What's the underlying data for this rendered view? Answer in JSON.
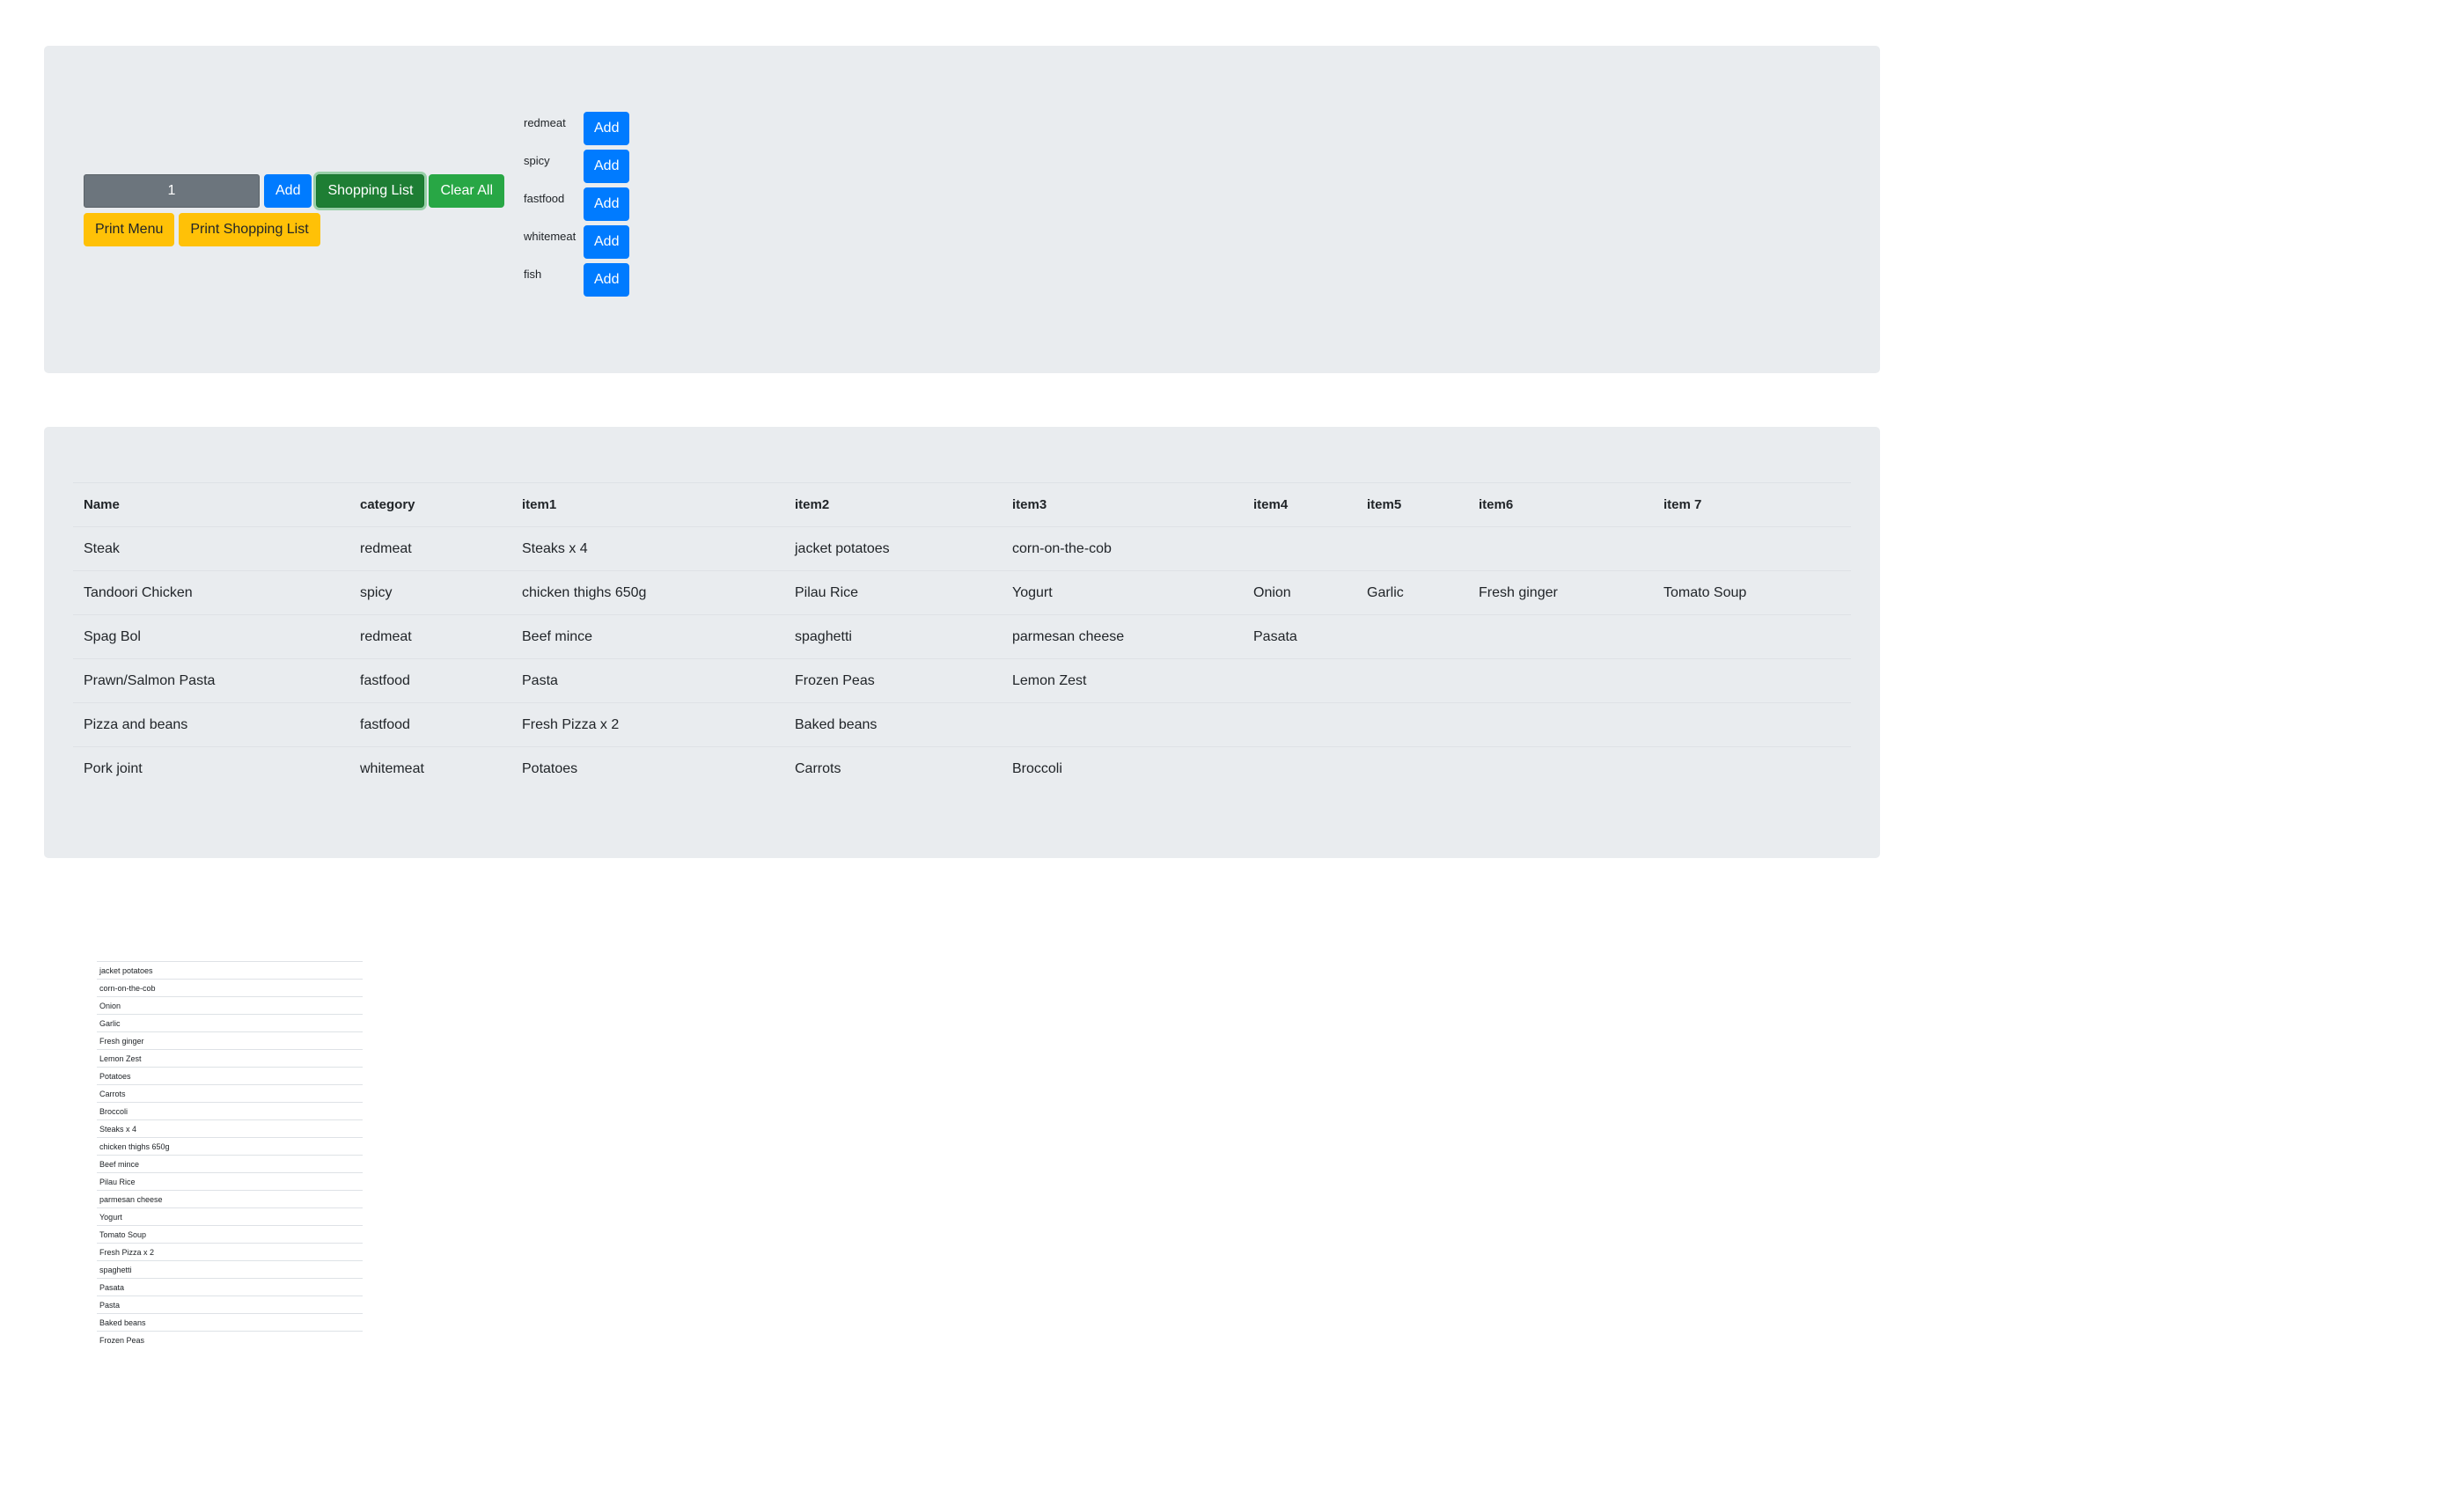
{
  "controls": {
    "quantity_value": "1",
    "add_label": "Add",
    "shopping_list_label": "Shopping List",
    "clear_all_label": "Clear All",
    "print_menu_label": "Print Menu",
    "print_shopping_list_label": "Print Shopping List"
  },
  "categories": [
    {
      "label": "redmeat",
      "button": "Add"
    },
    {
      "label": "spicy",
      "button": "Add"
    },
    {
      "label": "fastfood",
      "button": "Add"
    },
    {
      "label": "whitemeat",
      "button": "Add"
    },
    {
      "label": "fish",
      "button": "Add"
    }
  ],
  "menu": {
    "headers": [
      "Name",
      "category",
      "item1",
      "item2",
      "item3",
      "item4",
      "item5",
      "item6",
      "item 7"
    ],
    "rows": [
      [
        "Steak",
        "redmeat",
        "Steaks x 4",
        "jacket potatoes",
        "corn-on-the-cob",
        "",
        "",
        "",
        ""
      ],
      [
        "Tandoori Chicken",
        "spicy",
        "chicken thighs 650g",
        "Pilau Rice",
        "Yogurt",
        "Onion",
        "Garlic",
        "Fresh ginger",
        "Tomato Soup"
      ],
      [
        "Spag Bol",
        "redmeat",
        "Beef mince",
        "spaghetti",
        "parmesan cheese",
        "Pasata",
        "",
        "",
        ""
      ],
      [
        "Prawn/Salmon Pasta",
        "fastfood",
        "Pasta",
        "Frozen Peas",
        "Lemon Zest",
        "",
        "",
        "",
        ""
      ],
      [
        "Pizza and beans",
        "fastfood",
        "Fresh Pizza x 2",
        "Baked beans",
        "",
        "",
        "",
        "",
        ""
      ],
      [
        "Pork joint",
        "whitemeat",
        "Potatoes",
        "Carrots",
        "Broccoli",
        "",
        "",
        "",
        ""
      ]
    ]
  },
  "shopping_list": [
    "jacket potatoes",
    "corn-on-the-cob",
    "Onion",
    "Garlic",
    "Fresh ginger",
    "Lemon Zest",
    "Potatoes",
    "Carrots",
    "Broccoli",
    "Steaks x 4",
    "chicken thighs 650g",
    "Beef mince",
    "Pilau Rice",
    "parmesan cheese",
    "Yogurt",
    "Tomato Soup",
    "Fresh Pizza x 2",
    "spaghetti",
    "Pasata",
    "Pasta",
    "Baked beans",
    "Frozen Peas"
  ]
}
